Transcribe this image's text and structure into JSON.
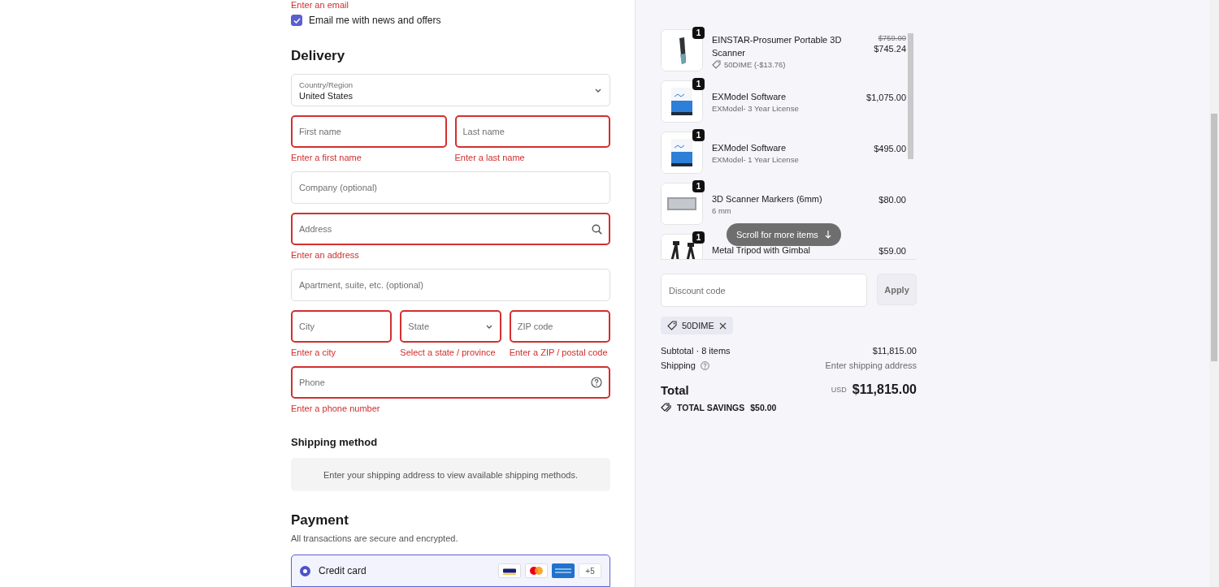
{
  "contact": {
    "error": "Enter an email",
    "newsletter": {
      "label": "Email me with news and offers",
      "checked": true
    }
  },
  "delivery": {
    "title": "Delivery",
    "country": {
      "label": "Country/Region",
      "value": "United States"
    },
    "rows": [
      [
        {
          "placeholder": "First name",
          "kind": "text",
          "invalid": true,
          "error": "Enter a first name"
        },
        {
          "placeholder": "Last name",
          "kind": "text",
          "invalid": true,
          "error": "Enter a last name"
        }
      ],
      [
        {
          "placeholder": "Company (optional)",
          "kind": "text",
          "invalid": false
        }
      ],
      [
        {
          "placeholder": "Address",
          "kind": "search",
          "invalid": true,
          "error": "Enter an address"
        }
      ],
      [
        {
          "placeholder": "Apartment, suite, etc. (optional)",
          "kind": "text",
          "invalid": false
        }
      ],
      [
        {
          "placeholder": "City",
          "kind": "text",
          "invalid": true,
          "error": "Enter a city"
        },
        {
          "placeholder": "State",
          "kind": "select",
          "invalid": true,
          "error": "Select a state / province"
        },
        {
          "placeholder": "ZIP code",
          "kind": "text",
          "invalid": true,
          "error": "Enter a ZIP / postal code"
        }
      ],
      [
        {
          "placeholder": "Phone",
          "kind": "help",
          "invalid": true,
          "error": "Enter a phone number"
        }
      ]
    ]
  },
  "shipping_method": {
    "title": "Shipping method",
    "notice": "Enter your shipping address to view available shipping methods."
  },
  "payment": {
    "title": "Payment",
    "subtitle": "All transactions are secure and encrypted.",
    "options": [
      {
        "label": "Credit card",
        "selected": true,
        "more": "+5"
      }
    ]
  },
  "cart": {
    "items": [
      {
        "name": "EINSTAR-Prosumer Portable 3D Scanner",
        "quantity": "1",
        "compare_price": "$759.00",
        "price": "$745.24",
        "discount": "50DIME (-$13.76)"
      },
      {
        "name": "EXModel Software",
        "quantity": "1",
        "variant": "EXModel- 3 Year License",
        "price": "$1,075.00"
      },
      {
        "name": "EXModel Software",
        "quantity": "1",
        "variant": "EXModel- 1 Year License",
        "price": "$495.00"
      },
      {
        "name": "3D Scanner Markers (6mm)",
        "quantity": "1",
        "variant": "6 mm",
        "price": "$80.00"
      },
      {
        "name": "Metal Tripod with Gimbal",
        "quantity": "1",
        "price": "$59.00"
      }
    ],
    "scroll_hint": "Scroll for more items",
    "discount": {
      "placeholder": "Discount code",
      "button": "Apply",
      "applied": [
        "50DIME"
      ]
    },
    "subtotal": {
      "label": "Subtotal · 8 items",
      "value": "$11,815.00"
    },
    "shipping": {
      "label": "Shipping",
      "value": "Enter shipping address"
    },
    "total": {
      "label": "Total",
      "currency": "USD",
      "value": "$11,815.00"
    },
    "savings": {
      "label": "TOTAL SAVINGS",
      "value": "$50.00"
    }
  }
}
